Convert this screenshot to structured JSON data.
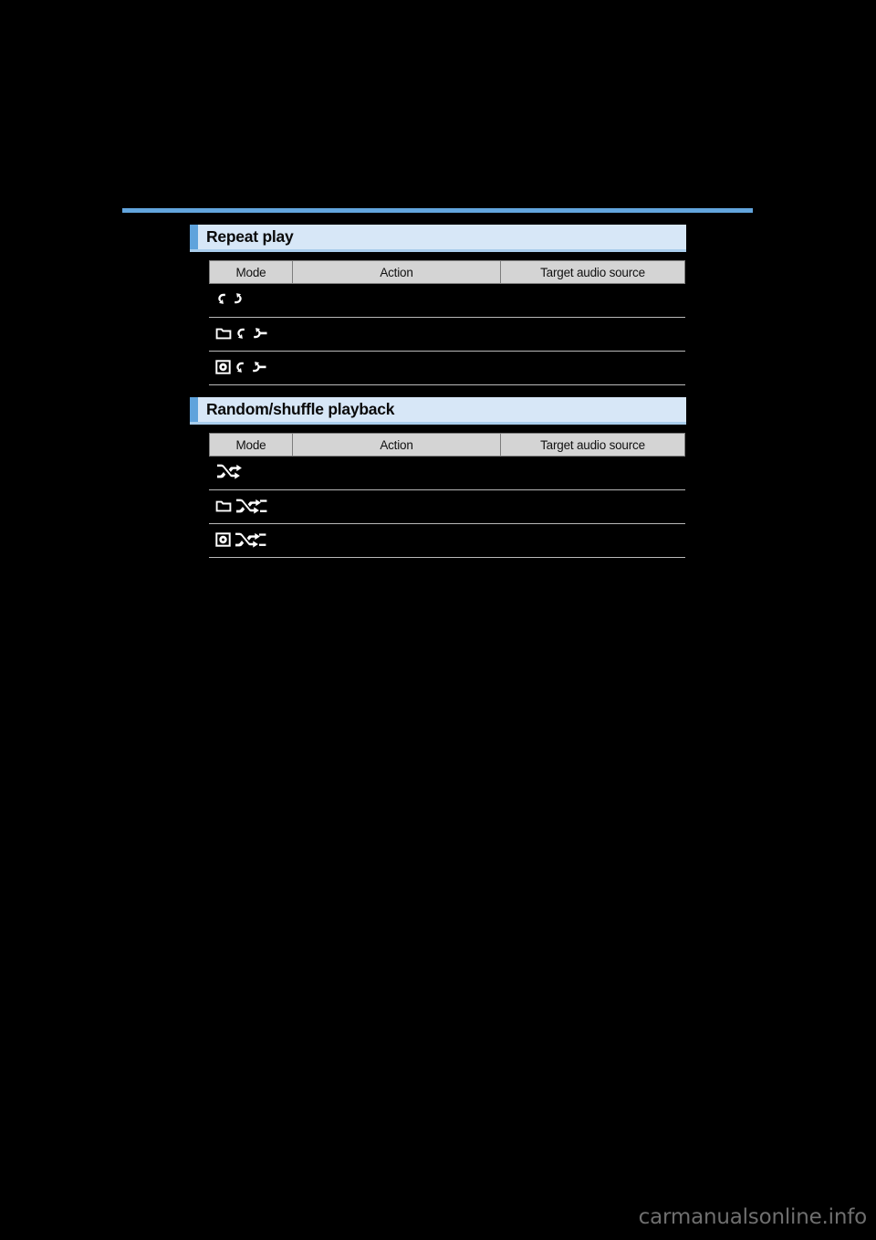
{
  "page": {
    "background_color": "#000000",
    "rule_color": "#62a5dd",
    "accent_color": "#5fa3dc",
    "header_band_color": "#d7e7f7",
    "table_header_color": "#d4d4d4"
  },
  "sections": [
    {
      "id": "repeat",
      "title": "Repeat play",
      "table": {
        "columns": [
          "Mode",
          "Action",
          "Target audio source"
        ],
        "rows": [
          {
            "mode_icon": "repeat-track-icon",
            "action": "",
            "target": ""
          },
          {
            "mode_icon": "repeat-folder-icon",
            "action": "",
            "target": ""
          },
          {
            "mode_icon": "repeat-disc-icon",
            "action": "",
            "target": ""
          }
        ]
      }
    },
    {
      "id": "random",
      "title": "Random/shuffle playback",
      "table": {
        "columns": [
          "Mode",
          "Action",
          "Target audio source"
        ],
        "rows": [
          {
            "mode_icon": "shuffle-track-icon",
            "action": "",
            "target": ""
          },
          {
            "mode_icon": "shuffle-folder-icon",
            "action": "",
            "target": ""
          },
          {
            "mode_icon": "shuffle-disc-icon",
            "action": "",
            "target": ""
          }
        ]
      }
    }
  ],
  "watermark": {
    "text": "carmanualsonline.info",
    "color": "#6f6f6f"
  }
}
